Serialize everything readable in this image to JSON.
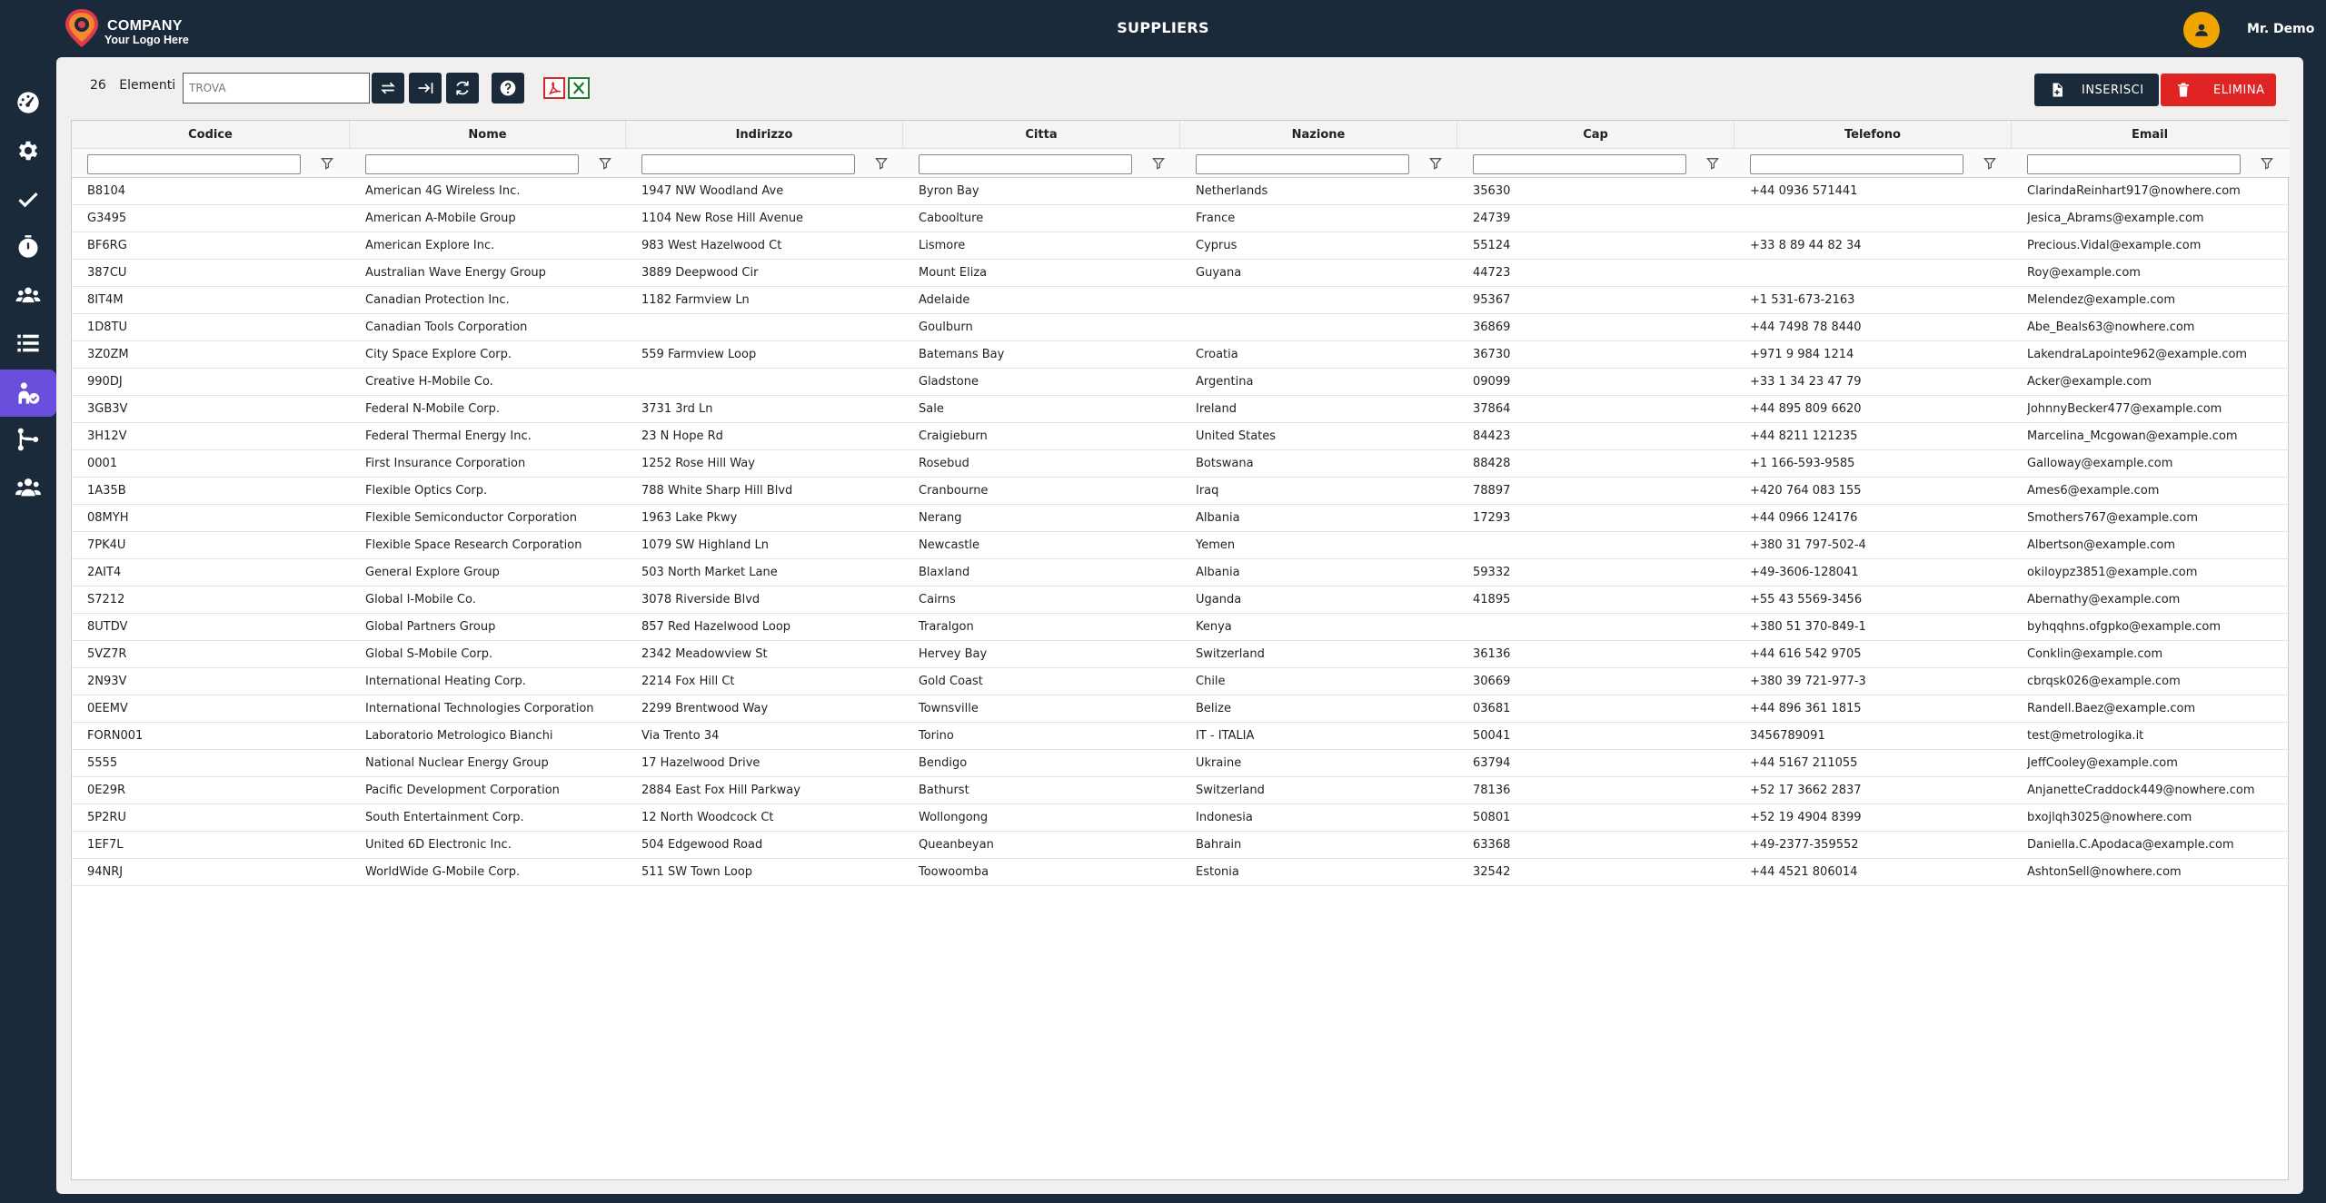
{
  "header": {
    "company": "COMPANY",
    "tagline": "Your Logo Here",
    "title": "SUPPLIERS",
    "user": "Mr. Demo"
  },
  "colors": {
    "background": "#1b2a3a",
    "accent_active": "#6a4fdc",
    "delete": "#e02424",
    "avatar": "#f0a500"
  },
  "sidebar": {
    "items": [
      {
        "icon": "dashboard-icon",
        "active": false
      },
      {
        "icon": "gear-icon",
        "active": false
      },
      {
        "icon": "check-icon",
        "active": false
      },
      {
        "icon": "stopwatch-icon",
        "active": false
      },
      {
        "icon": "group-icon",
        "active": false
      },
      {
        "icon": "list-icon",
        "active": false
      },
      {
        "icon": "supplier-icon",
        "active": true
      },
      {
        "icon": "flow-icon",
        "active": false
      },
      {
        "icon": "users-icon",
        "active": false
      }
    ]
  },
  "toolbar": {
    "count": "26",
    "count_label": "Elementi",
    "search_placeholder": "TROVA",
    "insert_label": "INSERISCI",
    "delete_label": "ELIMINA"
  },
  "table": {
    "columns": [
      "Codice",
      "Nome",
      "Indirizzo",
      "Citta",
      "Nazione",
      "Cap",
      "Telefono",
      "Email"
    ],
    "rows": [
      [
        "B8104",
        "American 4G Wireless Inc.",
        "1947 NW Woodland Ave",
        "Byron Bay",
        "Netherlands",
        "35630",
        "+44 0936 571441",
        "ClarindaReinhart917@nowhere.com"
      ],
      [
        "G3495",
        "American A-Mobile Group",
        "1104 New Rose Hill Avenue",
        "Caboolture",
        "France",
        "24739",
        "",
        "Jesica_Abrams@example.com"
      ],
      [
        "BF6RG",
        "American Explore Inc.",
        "983 West Hazelwood Ct",
        "Lismore",
        "Cyprus",
        "55124",
        "+33 8 89 44 82 34",
        "Precious.Vidal@example.com"
      ],
      [
        "387CU",
        "Australian Wave Energy Group",
        "3889 Deepwood Cir",
        "Mount Eliza",
        "Guyana",
        "44723",
        "",
        "Roy@example.com"
      ],
      [
        "8IT4M",
        "Canadian Protection Inc.",
        "1182 Farmview Ln",
        "Adelaide",
        "",
        "95367",
        "+1 531-673-2163",
        "Melendez@example.com"
      ],
      [
        "1D8TU",
        "Canadian Tools Corporation",
        "",
        "Goulburn",
        "",
        "36869",
        "+44 7498 78 8440",
        "Abe_Beals63@nowhere.com"
      ],
      [
        "3Z0ZM",
        "City Space Explore Corp.",
        "559 Farmview Loop",
        "Batemans Bay",
        "Croatia",
        "36730",
        "+971 9 984 1214",
        "LakendraLapointe962@example.com"
      ],
      [
        "990DJ",
        "Creative H-Mobile Co.",
        "",
        "Gladstone",
        "Argentina",
        "09099",
        "+33 1 34 23 47 79",
        "Acker@example.com"
      ],
      [
        "3GB3V",
        "Federal N-Mobile Corp.",
        "3731 3rd Ln",
        "Sale",
        "Ireland",
        "37864",
        "+44 895 809 6620",
        "JohnnyBecker477@example.com"
      ],
      [
        "3H12V",
        "Federal Thermal Energy Inc.",
        "23 N Hope Rd",
        "Craigieburn",
        "United States",
        "84423",
        "+44 8211 121235",
        "Marcelina_Mcgowan@example.com"
      ],
      [
        "0001",
        "First Insurance Corporation",
        "1252 Rose Hill Way",
        "Rosebud",
        "Botswana",
        "88428",
        "+1 166-593-9585",
        "Galloway@example.com"
      ],
      [
        "1A35B",
        "Flexible Optics Corp.",
        "788 White Sharp Hill Blvd",
        "Cranbourne",
        "Iraq",
        "78897",
        "+420 764 083 155",
        "Ames6@example.com"
      ],
      [
        "08MYH",
        "Flexible Semiconductor Corporation",
        "1963 Lake Pkwy",
        "Nerang",
        "Albania",
        "17293",
        "+44 0966 124176",
        "Smothers767@example.com"
      ],
      [
        "7PK4U",
        "Flexible Space Research Corporation",
        "1079 SW Highland Ln",
        "Newcastle",
        "Yemen",
        "",
        "+380 31 797-502-4",
        "Albertson@example.com"
      ],
      [
        "2AIT4",
        "General Explore Group",
        "503 North Market Lane",
        "Blaxland",
        "Albania",
        "59332",
        "+49-3606-128041",
        "okiloypz3851@example.com"
      ],
      [
        "S7212",
        "Global I-Mobile Co.",
        "3078 Riverside Blvd",
        "Cairns",
        "Uganda",
        "41895",
        "+55 43 5569-3456",
        "Abernathy@example.com"
      ],
      [
        "8UTDV",
        "Global Partners Group",
        "857 Red Hazelwood Loop",
        "Traralgon",
        "Kenya",
        "",
        "+380 51 370-849-1",
        "byhqqhns.ofgpko@example.com"
      ],
      [
        "5VZ7R",
        "Global S-Mobile Corp.",
        "2342 Meadowview St",
        "Hervey Bay",
        "Switzerland",
        "36136",
        "+44 616 542 9705",
        "Conklin@example.com"
      ],
      [
        "2N93V",
        "International Heating Corp.",
        "2214 Fox Hill Ct",
        "Gold Coast",
        "Chile",
        "30669",
        "+380 39 721-977-3",
        "cbrqsk026@example.com"
      ],
      [
        "0EEMV",
        "International Technologies Corporation",
        "2299 Brentwood Way",
        "Townsville",
        "Belize",
        "03681",
        "+44 896 361 1815",
        "Randell.Baez@example.com"
      ],
      [
        "FORN001",
        "Laboratorio Metrologico Bianchi",
        "Via Trento 34",
        "Torino",
        "IT - ITALIA",
        "50041",
        "3456789091",
        "test@metrologika.it"
      ],
      [
        "5555",
        "National Nuclear Energy Group",
        "17 Hazelwood Drive",
        "Bendigo",
        "Ukraine",
        "63794",
        "+44 5167 211055",
        "JeffCooley@example.com"
      ],
      [
        "0E29R",
        "Pacific Development Corporation",
        "2884 East Fox Hill Parkway",
        "Bathurst",
        "Switzerland",
        "78136",
        "+52 17 3662 2837",
        "AnjanetteCraddock449@nowhere.com"
      ],
      [
        "5P2RU",
        "South Entertainment Corp.",
        "12 North Woodcock Ct",
        "Wollongong",
        "Indonesia",
        "50801",
        "+52 19 4904 8399",
        "bxojlqh3025@nowhere.com"
      ],
      [
        "1EF7L",
        "United 6D Electronic Inc.",
        "504 Edgewood Road",
        "Queanbeyan",
        "Bahrain",
        "63368",
        "+49-2377-359552",
        "Daniella.C.Apodaca@example.com"
      ],
      [
        "94NRJ",
        "WorldWide G-Mobile Corp.",
        "511 SW Town Loop",
        "Toowoomba",
        "Estonia",
        "32542",
        "+44 4521 806014",
        "AshtonSell@nowhere.com"
      ]
    ]
  }
}
